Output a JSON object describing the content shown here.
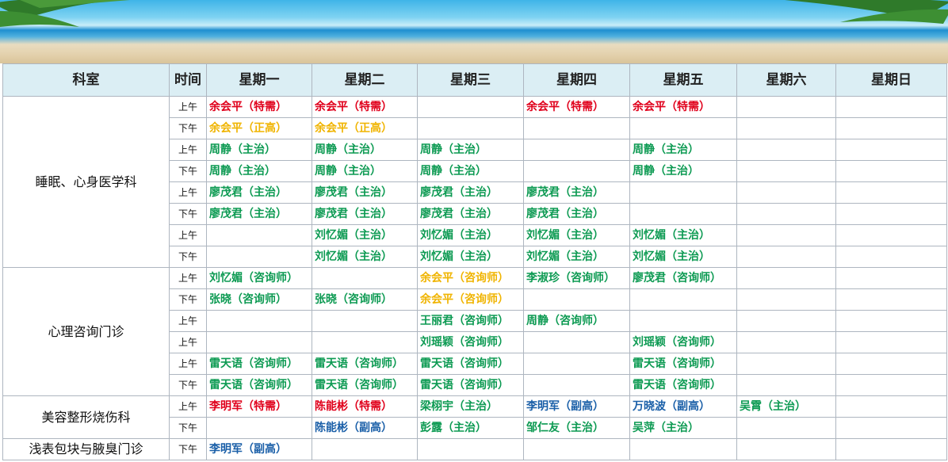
{
  "headers": [
    "科室",
    "时间",
    "星期一",
    "星期二",
    "星期三",
    "星期四",
    "星期五",
    "星期六",
    "星期日"
  ],
  "colors": {
    "r": "#e0001b",
    "y": "#f0b400",
    "g": "#0c9a52",
    "b": "#1a5fa8"
  },
  "departments": [
    {
      "name": "睡眠、心身医学科",
      "rows": [
        {
          "period": "上午",
          "cells": [
            [
              "余会平（特需）",
              "r"
            ],
            [
              "余会平（特需）",
              "r"
            ],
            [
              "",
              ""
            ],
            [
              "余会平（特需）",
              "r"
            ],
            [
              "余会平（特需）",
              "r"
            ],
            [
              "",
              ""
            ],
            [
              "",
              ""
            ]
          ]
        },
        {
          "period": "下午",
          "cells": [
            [
              "余会平（正高）",
              "y"
            ],
            [
              "余会平（正高）",
              "y"
            ],
            [
              "",
              ""
            ],
            [
              "",
              ""
            ],
            [
              "",
              ""
            ],
            [
              "",
              ""
            ],
            [
              "",
              ""
            ]
          ]
        },
        {
          "period": "上午",
          "cells": [
            [
              "周静（主治）",
              "g"
            ],
            [
              "周静（主治）",
              "g"
            ],
            [
              "周静（主治）",
              "g"
            ],
            [
              "",
              ""
            ],
            [
              "周静（主治）",
              "g"
            ],
            [
              "",
              ""
            ],
            [
              "",
              ""
            ]
          ]
        },
        {
          "period": "下午",
          "cells": [
            [
              "周静（主治）",
              "g"
            ],
            [
              "周静（主治）",
              "g"
            ],
            [
              "周静（主治）",
              "g"
            ],
            [
              "",
              ""
            ],
            [
              "周静（主治）",
              "g"
            ],
            [
              "",
              ""
            ],
            [
              "",
              ""
            ]
          ]
        },
        {
          "period": "上午",
          "cells": [
            [
              "廖茂君（主治）",
              "g"
            ],
            [
              "廖茂君（主治）",
              "g"
            ],
            [
              "廖茂君（主治）",
              "g"
            ],
            [
              "廖茂君（主治）",
              "g"
            ],
            [
              "",
              ""
            ],
            [
              "",
              ""
            ],
            [
              "",
              ""
            ]
          ]
        },
        {
          "period": "下午",
          "cells": [
            [
              "廖茂君（主治）",
              "g"
            ],
            [
              "廖茂君（主治）",
              "g"
            ],
            [
              "廖茂君（主治）",
              "g"
            ],
            [
              "廖茂君（主治）",
              "g"
            ],
            [
              "",
              ""
            ],
            [
              "",
              ""
            ],
            [
              "",
              ""
            ]
          ]
        },
        {
          "period": "上午",
          "cells": [
            [
              "",
              ""
            ],
            [
              "刘忆媚（主治）",
              "g"
            ],
            [
              "刘忆媚（主治）",
              "g"
            ],
            [
              "刘忆媚（主治）",
              "g"
            ],
            [
              "刘忆媚（主治）",
              "g"
            ],
            [
              "",
              ""
            ],
            [
              "",
              ""
            ]
          ]
        },
        {
          "period": "下午",
          "cells": [
            [
              "",
              ""
            ],
            [
              "刘忆媚（主治）",
              "g"
            ],
            [
              "刘忆媚（主治）",
              "g"
            ],
            [
              "刘忆媚（主治）",
              "g"
            ],
            [
              "刘忆媚（主治）",
              "g"
            ],
            [
              "",
              ""
            ],
            [
              "",
              ""
            ]
          ]
        }
      ]
    },
    {
      "name": "心理咨询门诊",
      "rows": [
        {
          "period": "上午",
          "cells": [
            [
              "刘忆媚（咨询师）",
              "g"
            ],
            [
              "",
              ""
            ],
            [
              "余会平（咨询师）",
              "y"
            ],
            [
              "李淑珍（咨询师）",
              "g"
            ],
            [
              "廖茂君（咨询师）",
              "g"
            ],
            [
              "",
              ""
            ],
            [
              "",
              ""
            ]
          ]
        },
        {
          "period": "下午",
          "cells": [
            [
              "张晓（咨询师）",
              "g"
            ],
            [
              "张晓（咨询师）",
              "g"
            ],
            [
              "余会平（咨询师）",
              "y"
            ],
            [
              "",
              ""
            ],
            [
              "",
              ""
            ],
            [
              "",
              ""
            ],
            [
              "",
              ""
            ]
          ]
        },
        {
          "period": "上午",
          "cells": [
            [
              "",
              ""
            ],
            [
              "",
              ""
            ],
            [
              "王丽君（咨询师）",
              "g"
            ],
            [
              "周静（咨询师）",
              "g"
            ],
            [
              "",
              ""
            ],
            [
              "",
              ""
            ],
            [
              "",
              ""
            ]
          ]
        },
        {
          "period": "上午",
          "cells": [
            [
              "",
              ""
            ],
            [
              "",
              ""
            ],
            [
              "刘瑶颖（咨询师）",
              "g"
            ],
            [
              "",
              ""
            ],
            [
              "刘瑶颖（咨询师）",
              "g"
            ],
            [
              "",
              ""
            ],
            [
              "",
              ""
            ]
          ]
        },
        {
          "period": "上午",
          "cells": [
            [
              "雷天语（咨询师）",
              "g"
            ],
            [
              "雷天语（咨询师）",
              "g"
            ],
            [
              "雷天语（咨询师）",
              "g"
            ],
            [
              "",
              ""
            ],
            [
              "雷天语（咨询师）",
              "g"
            ],
            [
              "",
              ""
            ],
            [
              "",
              ""
            ]
          ]
        },
        {
          "period": "下午",
          "cells": [
            [
              "雷天语（咨询师）",
              "g"
            ],
            [
              "雷天语（咨询师）",
              "g"
            ],
            [
              "雷天语（咨询师）",
              "g"
            ],
            [
              "",
              ""
            ],
            [
              "雷天语（咨询师）",
              "g"
            ],
            [
              "",
              ""
            ],
            [
              "",
              ""
            ]
          ]
        }
      ]
    },
    {
      "name": "美容整形烧伤科",
      "rows": [
        {
          "period": "上午",
          "cells": [
            [
              "李明军（特需）",
              "r"
            ],
            [
              "陈能彬（特需）",
              "r"
            ],
            [
              "梁栩宇（主治）",
              "g"
            ],
            [
              "李明军（副高）",
              "b"
            ],
            [
              "万晓波（副高）",
              "b"
            ],
            [
              "吴霄（主治）",
              "g"
            ],
            [
              "",
              ""
            ]
          ]
        },
        {
          "period": "下午",
          "cells": [
            [
              "",
              ""
            ],
            [
              "陈能彬（副高）",
              "b"
            ],
            [
              "彭露（主治）",
              "g"
            ],
            [
              "邹仁友（主治）",
              "g"
            ],
            [
              "吴萍（主治）",
              "g"
            ],
            [
              "",
              ""
            ],
            [
              "",
              ""
            ]
          ]
        }
      ]
    },
    {
      "name": "浅表包块与腋臭门诊",
      "rows": [
        {
          "period": "下午",
          "cells": [
            [
              "李明军（副高）",
              "b"
            ],
            [
              "",
              ""
            ],
            [
              "",
              ""
            ],
            [
              "",
              ""
            ],
            [
              "",
              ""
            ],
            [
              "",
              ""
            ],
            [
              "",
              ""
            ]
          ]
        }
      ]
    }
  ]
}
